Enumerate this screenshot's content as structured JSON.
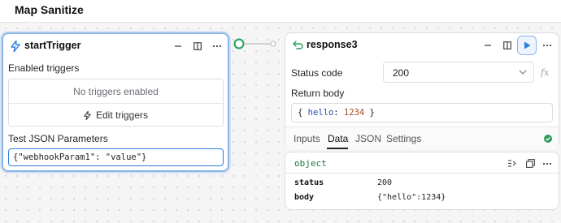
{
  "app": {
    "title": "Map Sanitize"
  },
  "trigger_node": {
    "title": "startTrigger",
    "enabled_triggers_label": "Enabled triggers",
    "no_triggers_text": "No triggers enabled",
    "edit_triggers_label": "Edit triggers",
    "test_params_label": "Test JSON Parameters",
    "test_params_value": "{\"webhookParam1\": \"value\"}"
  },
  "response_node": {
    "title": "response3",
    "status_code_label": "Status code",
    "status_code_value": "200",
    "return_body_label": "Return body",
    "return_body_key": "hello",
    "return_body_value": "1234",
    "return_body_open": "{",
    "return_body_colon": ":",
    "return_body_close": "}",
    "tabs": [
      "Inputs",
      "Data",
      "JSON",
      "Settings"
    ],
    "active_tab": "Data"
  },
  "output_panel": {
    "type_label": "object",
    "rows": [
      {
        "key": "status",
        "value": "200"
      },
      {
        "key": "body",
        "value": "{\"hello\":1234}"
      }
    ]
  },
  "colors": {
    "accent": "#2f7de1",
    "selected_border": "#8ab4e8",
    "success": "#2e9e5b",
    "connector": "#22a05b",
    "string_value": "#a14a1b",
    "key_blue": "#1a4fb3"
  },
  "icons": {
    "trigger": "lightning-icon",
    "response": "return-arrow-icon",
    "minimize": "minus-icon",
    "layout": "panel-icon",
    "more": "ellipsis-icon",
    "run": "play-icon",
    "formula": "fx-icon",
    "chevron": "chevron-down-icon",
    "status_ok": "check-circle-icon"
  }
}
